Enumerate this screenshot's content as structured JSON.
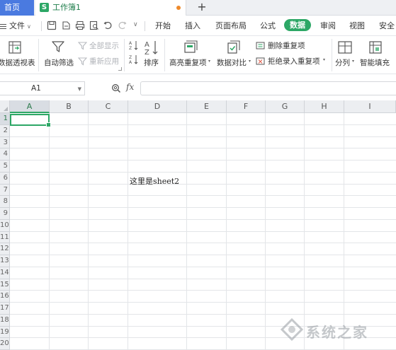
{
  "tabs": {
    "home_label": "首页",
    "doc_logo": "S",
    "doc_title": "工作簿1",
    "new_tab": "+"
  },
  "menu": {
    "file_label": "文件",
    "items": [
      {
        "label": "开始"
      },
      {
        "label": "插入"
      },
      {
        "label": "页面布局"
      },
      {
        "label": "公式"
      },
      {
        "label": "数据",
        "active": true
      },
      {
        "label": "审阅"
      },
      {
        "label": "视图"
      },
      {
        "label": "安全"
      }
    ]
  },
  "ribbon": {
    "pivot_label": "数据透视表",
    "autofilter_label": "自动筛选",
    "show_all_label": "全部显示",
    "reapply_label": "重新应用",
    "sort_label": "排序",
    "highlight_dup_label": "高亮重复项",
    "compare_label": "数据对比",
    "remove_dup_label": "删除重复项",
    "reject_dup_label": "拒绝录入重复项",
    "split_label": "分列",
    "smart_fill_label": "智能填充"
  },
  "formula_bar": {
    "cell_ref": "A1",
    "fx": "fx",
    "value": ""
  },
  "sheet": {
    "columns": [
      "A",
      "B",
      "C",
      "D",
      "E",
      "F",
      "G",
      "H",
      "I"
    ],
    "selected_column": "A",
    "rows": [
      "1",
      "2",
      "3",
      "4",
      "5",
      "6",
      "7",
      "8",
      "9",
      "10",
      "11",
      "12",
      "13",
      "14",
      "15",
      "16",
      "17",
      "18",
      "19",
      "20"
    ],
    "selected_row": "1",
    "active_cell": "A1",
    "cells": [
      {
        "ref": "D6",
        "value": "这里是sheet2"
      }
    ]
  },
  "watermark": {
    "text": "系统之家"
  },
  "colors": {
    "accent": "#2da766",
    "home_tab": "#4a7ae0",
    "modified_dot": "#ee8a2b"
  }
}
